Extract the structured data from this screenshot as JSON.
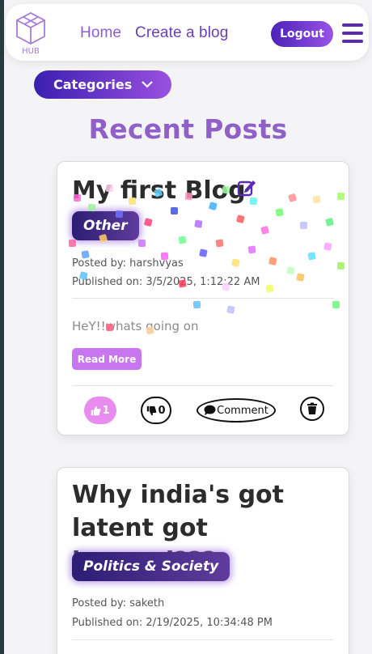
{
  "nav": {
    "logo_text": "HUB",
    "home": "Home",
    "create": "Create a blog",
    "logout": "Logout"
  },
  "categories_label": "Categories",
  "section_title": "Recent Posts",
  "posts": [
    {
      "title": "My first Blog",
      "category": "Other",
      "posted_by": "Posted by: harshvyas",
      "published_on": "Published on: 3/5/2025, 1:12:22 AM",
      "excerpt": "HeY!!whats going on",
      "read_more": "Read More",
      "likes": "1",
      "dislikes": "0",
      "comment_label": "Comment"
    },
    {
      "title": "Why india's got latent got banned???",
      "category": "Politics & Society",
      "posted_by": "Posted by: saketh",
      "published_on": "Published on: 2/19/2025, 10:34:48 PM"
    }
  ],
  "colors": {
    "accent": "#7e4fd0",
    "like": "#e88cf0",
    "read_more": "#c776f0",
    "title": "#9060c8"
  }
}
